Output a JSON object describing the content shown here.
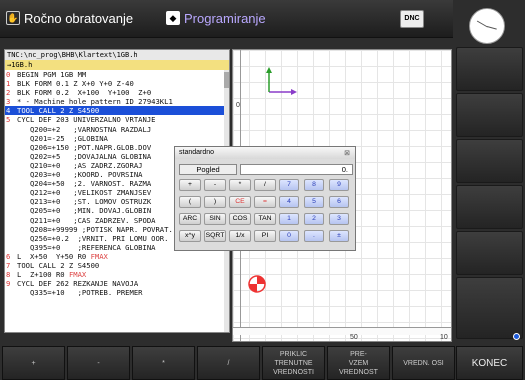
{
  "header": {
    "mode_machine": "Ročno obratovanje",
    "mode_prog": "Programiranje",
    "dnc": "DNC"
  },
  "program": {
    "path": "TNC:\\nc_prog\\BHB\\Klartext\\1GB.h",
    "file": "→1GB.h",
    "lines": [
      {
        "n": "0",
        "t": "BEGIN PGM 1GB MM"
      },
      {
        "n": "1",
        "t": "BLK FORM 0.1 Z X+0 Y+0 Z-40"
      },
      {
        "n": "2",
        "t": "BLK FORM 0.2  X+100  Y+100  Z+0"
      },
      {
        "n": "3",
        "t": "* - Machine hole pattern ID 27943KL1"
      },
      {
        "n": "4",
        "t": "TOOL CALL 2 Z S4500",
        "cur": true
      },
      {
        "n": "5",
        "t": "CYCL DEF 203 UNIVERZALNO VRTANJE"
      },
      {
        "n": "",
        "t": "   Q200=+2   ;VARNOSTNA RAZDALJ"
      },
      {
        "n": "",
        "t": "   Q201=-25  ;GLOBINA"
      },
      {
        "n": "",
        "t": "   Q206=+150 ;POT.NAPR.GLOB.DOV"
      },
      {
        "n": "",
        "t": "   Q202=+5   ;DOVAJALNA GLOBINA"
      },
      {
        "n": "",
        "t": "   Q210=+0   ;AS ZADRZ.ZGORAJ"
      },
      {
        "n": "",
        "t": "   Q203=+0   ;KOORD. POVRSINA"
      },
      {
        "n": "",
        "t": "   Q204=+50  ;2. VARNOST. RAZMA"
      },
      {
        "n": "",
        "t": "   Q212=+0   ;VELIKOST ZMANJSEV"
      },
      {
        "n": "",
        "t": "   Q213=+0   ;ST. LOMOV OSTRUZK"
      },
      {
        "n": "",
        "t": "   Q205=+0   ;MIN. DOVAJ.GLOBIN"
      },
      {
        "n": "",
        "t": "   Q211=+0   ;CAS ZADRZEV. SPODA"
      },
      {
        "n": "",
        "t": "   Q208=+99999 ;POTISK NAPR. POVRAT."
      },
      {
        "n": "",
        "t": "   Q256=+0.2  ;VRNIT. PRI LOMU OOR."
      },
      {
        "n": "",
        "t": "   Q395=+0    ;REFERENCA GLOBINA"
      },
      {
        "n": "6",
        "t": "L  X+50  Y+50 R0 ",
        "extra": "FMAX"
      },
      {
        "n": "7",
        "t": "TOOL CALL 2 Z S4500"
      },
      {
        "n": "8",
        "t": "L  Z+100 R0 ",
        "extra": "FMAX"
      },
      {
        "n": "9",
        "t": "CYCL DEF 262 REZKANJE NAVOJA"
      },
      {
        "n": "",
        "t": "   Q335=+10   ;POTREB. PREMER"
      }
    ]
  },
  "graphics": {
    "ruler_h": [
      "50",
      "10"
    ],
    "ruler_v": [
      "0"
    ]
  },
  "calculator": {
    "title": "standardno",
    "view_button": "Pogled",
    "display": "0.",
    "rows": [
      [
        "+",
        "-",
        "*",
        "/",
        "7",
        "8",
        "9"
      ],
      [
        "(",
        ")",
        "CE",
        "=",
        "4",
        "5",
        "6"
      ],
      [
        "ARC",
        "SIN",
        "COS",
        "TAN",
        "1",
        "2",
        "3"
      ],
      [
        "x^y",
        "SQRT",
        "1/x",
        "PI",
        "0",
        ".",
        "±"
      ]
    ]
  },
  "softkeys": [
    "+",
    "-",
    "*",
    "/",
    "PRIKLIC\nTRENUTNE\nVREDNOSTI",
    "PRE-\nVZEM\nVREDNOST",
    "VREDN. OSI",
    "KONEC"
  ]
}
